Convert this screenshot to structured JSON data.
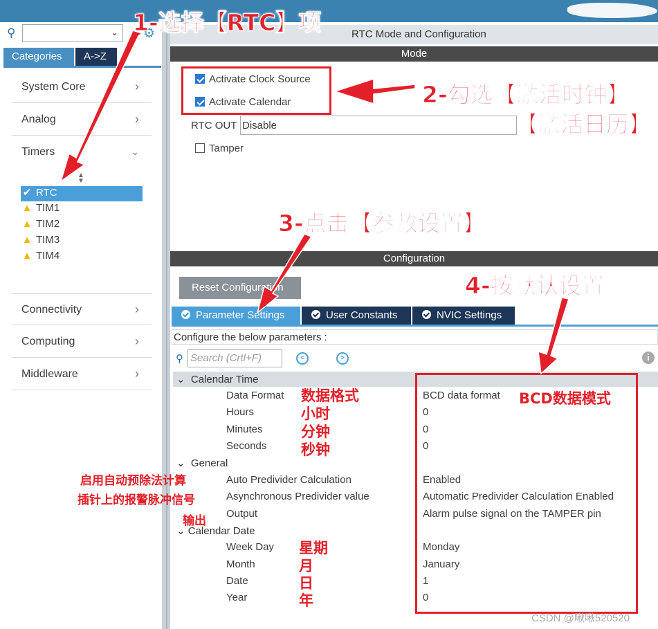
{
  "window": {
    "title": "RTC Mode and Configuration"
  },
  "left": {
    "search_value": "",
    "tabs": [
      "Categories",
      "A->Z"
    ],
    "categories": [
      "System Core",
      "Analog",
      "Timers",
      "Connectivity",
      "Computing",
      "Middleware"
    ],
    "timers": [
      {
        "label": "RTC",
        "state": "ok"
      },
      {
        "label": "TIM1",
        "state": "warn"
      },
      {
        "label": "TIM2",
        "state": "warn"
      },
      {
        "label": "TIM3",
        "state": "warn"
      },
      {
        "label": "TIM4",
        "state": "warn"
      }
    ]
  },
  "mode": {
    "header": "Mode",
    "activate_clock": "Activate Clock Source",
    "activate_calendar": "Activate Calendar",
    "rtc_out_label": "RTC OUT",
    "rtc_out_value": "Disable",
    "tamper": "Tamper"
  },
  "config": {
    "header": "Configuration",
    "reset_button": "Reset Configuration",
    "tabs": [
      "Parameter Settings",
      "User Constants",
      "NVIC Settings"
    ],
    "configure_text": "Configure the below parameters :",
    "search_placeholder": "Search (Crtl+F)",
    "groups": {
      "calendar_time": "Calendar Time",
      "general": "General",
      "calendar_date": "Calendar Date"
    },
    "params": {
      "data_format": {
        "name": "Data Format",
        "value": "BCD data format"
      },
      "hours": {
        "name": "Hours",
        "value": "0"
      },
      "minutes": {
        "name": "Minutes",
        "value": "0"
      },
      "seconds": {
        "name": "Seconds",
        "value": "0"
      },
      "auto_predivider": {
        "name": "Auto Predivider Calculation",
        "value": "Enabled"
      },
      "async_predivider": {
        "name": "Asynchronous Predivider value",
        "value": "Automatic Predivider Calculation Enabled"
      },
      "output": {
        "name": "Output",
        "value": "Alarm pulse signal on the TAMPER pin"
      },
      "week_day": {
        "name": "Week Day",
        "value": "Monday"
      },
      "month": {
        "name": "Month",
        "value": "January"
      },
      "date": {
        "name": "Date",
        "value": "1"
      },
      "year": {
        "name": "Year",
        "value": "0"
      }
    }
  },
  "annotations": {
    "step1": "1-选择【RTC】项",
    "step2a": "2-勾选【激活时钟】",
    "step2b": "【激活日历】",
    "step3": "3-点击【参数设置】",
    "step4": "4-按默认设置",
    "data_format": "数据格式",
    "hours": "小时",
    "minutes": "分钟",
    "seconds": "秒钟",
    "general_note1": "启用自动预除法计算",
    "general_note2": "插针上的报警脉冲信号",
    "general_note3": "输出",
    "week": "星期",
    "month": "月",
    "day": "日",
    "year": "年",
    "bcd": "BCD数据模式"
  },
  "watermark": "CSDN @啾啾520520",
  "colors": {
    "accent": "#4a9fd8",
    "dark_tab": "#1d3557",
    "annotation_red": "#e3202a"
  }
}
